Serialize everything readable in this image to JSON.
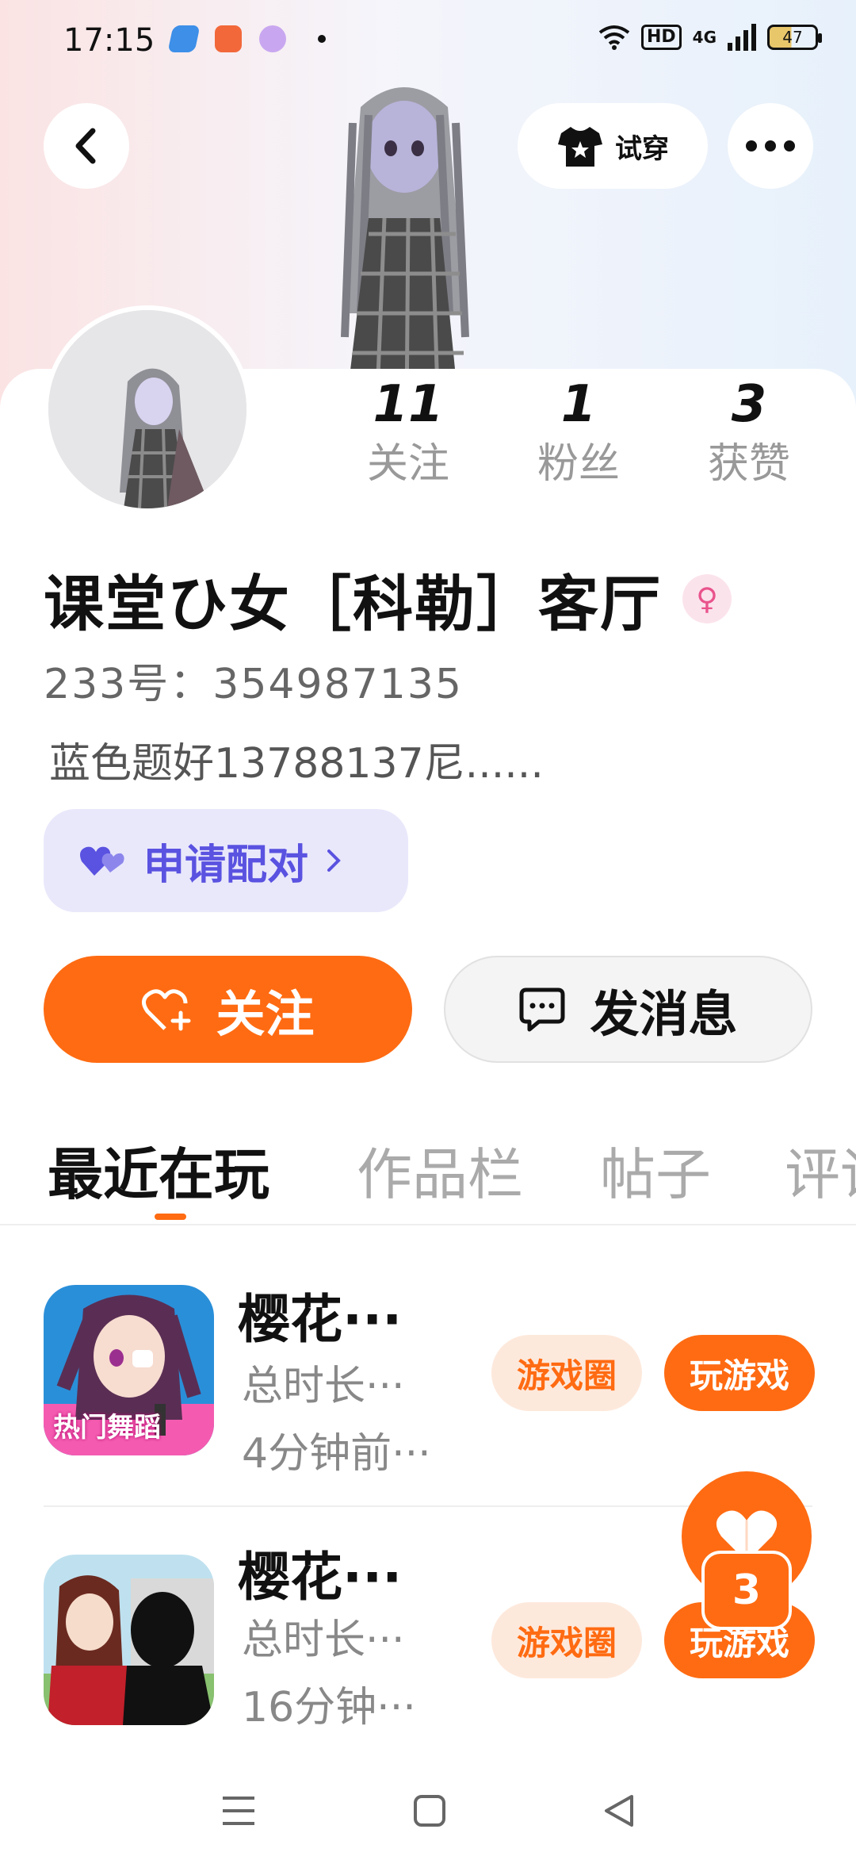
{
  "status_bar": {
    "time": "17:15",
    "hd": "HD",
    "network": "4G",
    "battery": "47"
  },
  "header": {
    "tryon_label": "试穿"
  },
  "profile": {
    "stats": [
      {
        "value": "11",
        "label": "关注"
      },
      {
        "value": "1",
        "label": "粉丝"
      },
      {
        "value": "3",
        "label": "获赞"
      }
    ],
    "name": "课堂ひ女［科勒］客厅",
    "uid": "233号：354987135",
    "bio": "蓝色题好13788137尼......",
    "pair_button": "申请配对"
  },
  "actions": {
    "follow": "关注",
    "message": "发消息"
  },
  "tabs": [
    "最近在玩",
    "作品栏",
    "帖子",
    "评论"
  ],
  "games": [
    {
      "title": "樱花···",
      "duration": "总时长···",
      "last_played": "4分钟前···",
      "icon_text": "热门舞蹈",
      "circle_btn": "游戏圈",
      "play_btn": "玩游戏"
    },
    {
      "title": "樱花···",
      "duration": "总时长···",
      "last_played": "16分钟···",
      "circle_btn": "游戏圈",
      "play_btn": "玩游戏"
    }
  ],
  "fab": {
    "badge": "3"
  },
  "colors": {
    "accent": "#ff6b12",
    "pair": "#5a52e0"
  }
}
